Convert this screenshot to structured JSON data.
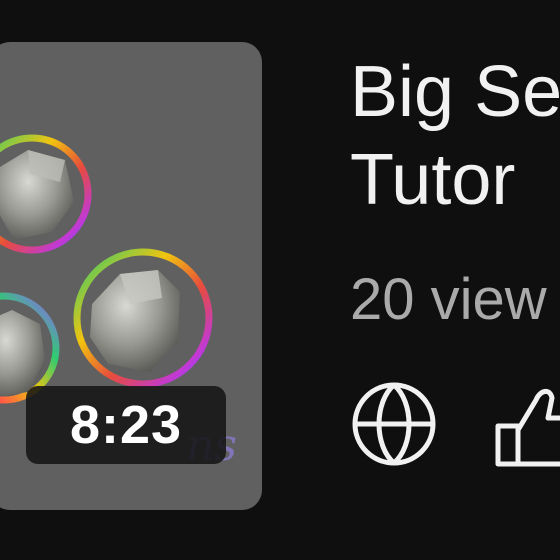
{
  "video": {
    "duration": "8:23",
    "title_line1": "Big Se",
    "title_line2": "Tutor",
    "views": "20 view"
  },
  "icons": {
    "visibility": "globe-icon",
    "like": "thumbs-up-icon"
  },
  "colors": {
    "background": "#0f0f0f",
    "thumbnail_bg": "#606060",
    "title": "#f1f1f1",
    "meta": "#aaaaaa"
  }
}
